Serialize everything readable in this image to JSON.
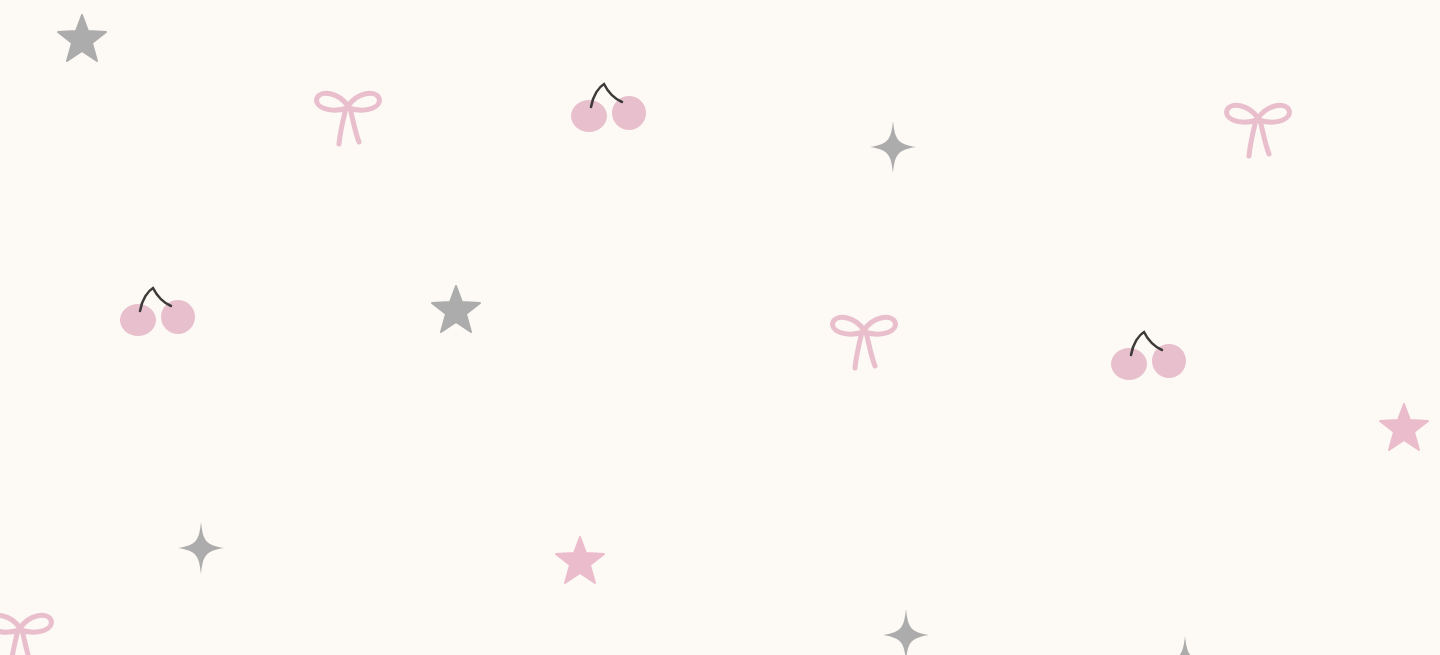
{
  "decorations": [
    {
      "kind": "star",
      "color": "#acacac"
    },
    {
      "kind": "bow",
      "color": "#e9bfcd"
    },
    {
      "kind": "cherry",
      "color": "#e8bfcd"
    },
    {
      "kind": "sparkle",
      "color": "#acacac"
    },
    {
      "kind": "bow",
      "color": "#e9bfcd"
    },
    {
      "kind": "cherry",
      "color": "#e8bfcd"
    },
    {
      "kind": "star",
      "color": "#acacac"
    },
    {
      "kind": "bow",
      "color": "#e9bfcd"
    },
    {
      "kind": "cherry",
      "color": "#e8bfcd"
    },
    {
      "kind": "star",
      "color": "#ebbccb"
    },
    {
      "kind": "sparkle",
      "color": "#acacac"
    },
    {
      "kind": "star",
      "color": "#ebbccb"
    },
    {
      "kind": "bow",
      "color": "#e9bfcd"
    },
    {
      "kind": "sparkle",
      "color": "#acacac"
    },
    {
      "kind": "sparkle",
      "color": "#acacac"
    }
  ]
}
